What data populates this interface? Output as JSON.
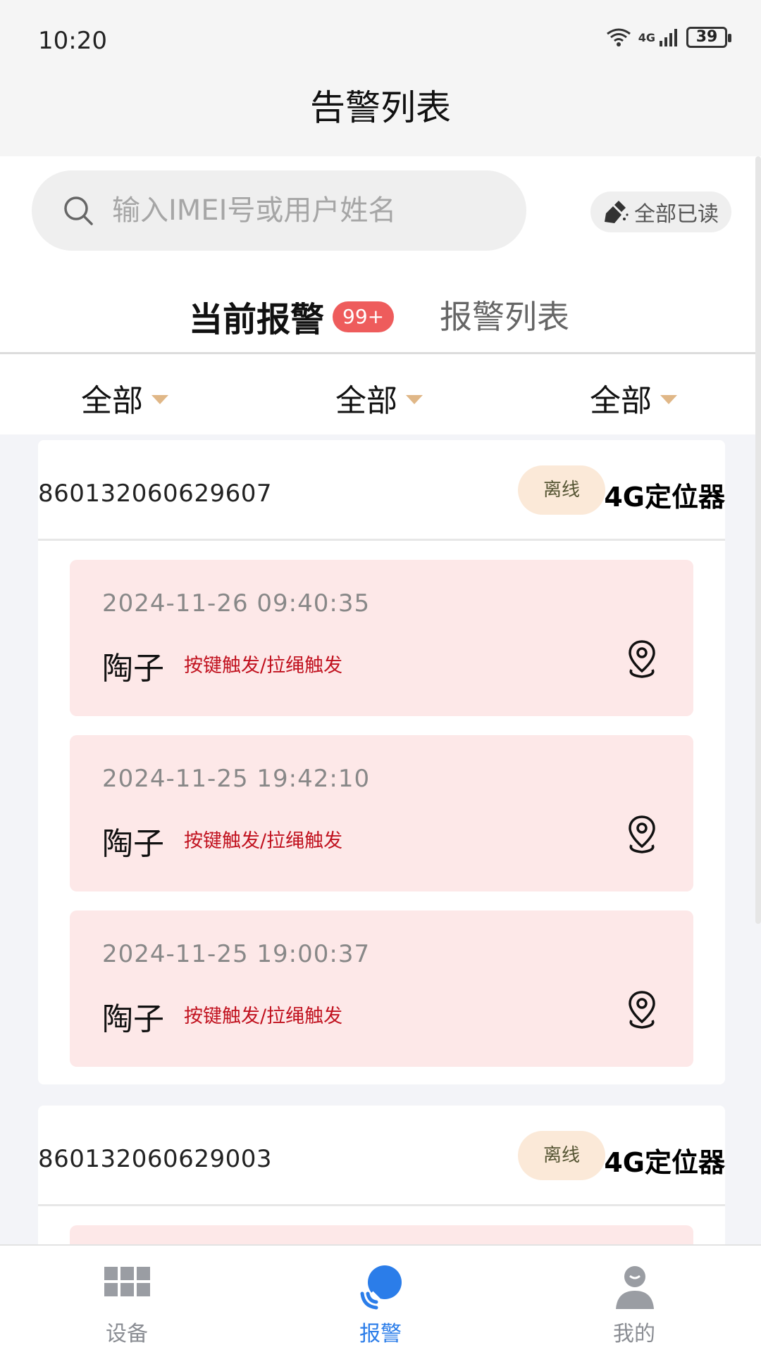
{
  "status": {
    "time": "10:20",
    "network": "4G",
    "battery": "39"
  },
  "header": {
    "title": "告警列表"
  },
  "search": {
    "placeholder": "输入IMEI号或用户姓名",
    "read_all_label": "全部已读"
  },
  "tabs": [
    {
      "label": "当前报警",
      "badge": "99+",
      "active": true
    },
    {
      "label": "报警列表",
      "active": false
    }
  ],
  "filters": [
    "全部",
    "全部",
    "全部"
  ],
  "devices": [
    {
      "imei": "860132060629607",
      "status": "离线",
      "type": "4G定位器",
      "alarms": [
        {
          "time": "2024-11-26 09:40:35",
          "name": "陶子",
          "type": "按键触发/拉绳触发"
        },
        {
          "time": "2024-11-25 19:42:10",
          "name": "陶子",
          "type": "按键触发/拉绳触发"
        },
        {
          "time": "2024-11-25 19:00:37",
          "name": "陶子",
          "type": "按键触发/拉绳触发"
        }
      ]
    },
    {
      "imei": "860132060629003",
      "status": "离线",
      "type": "4G定位器",
      "alarms": []
    }
  ],
  "bottom_nav": [
    {
      "label": "设备",
      "icon": "grid-icon",
      "active": false
    },
    {
      "label": "报警",
      "icon": "alarm-signal-icon",
      "active": true
    },
    {
      "label": "我的",
      "icon": "person-icon",
      "active": false
    }
  ],
  "colors": {
    "accent": "#2b7de9",
    "alarm_bg": "#fde8e8",
    "alarm_text": "#c1121f",
    "badge": "#ee5c5c"
  }
}
